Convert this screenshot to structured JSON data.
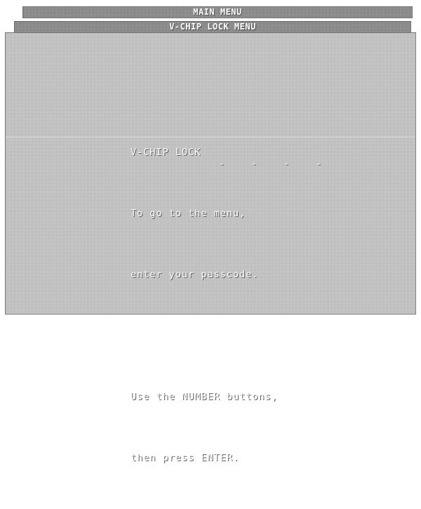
{
  "menus": {
    "main_menu_title": "MAIN MENU",
    "vchip_lock_menu_title": "V-CHIP LOCK MENU"
  },
  "prompt": {
    "heading": "V-CHIP LOCK",
    "line1": "To go to the menu,",
    "line2": "enter your passcode.",
    "passcode_slots": [
      "-",
      "-",
      "-",
      "-"
    ],
    "line3": "Use the NUMBER buttons,",
    "line4": "then press ENTER."
  },
  "colors": {
    "panel_gray": "#a9a9a9",
    "text": "#ffffff"
  }
}
